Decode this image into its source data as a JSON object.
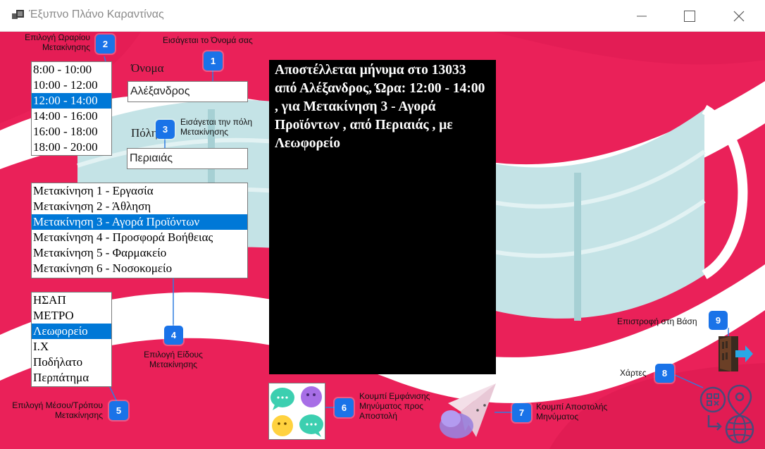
{
  "window": {
    "title": "Έξυπνο Πλάνο Καραντίνας"
  },
  "schedule": {
    "hint": "Επιλογή Ωραρίου Μετακίνησης",
    "hint_line1": "Επιλογή Ωραρίου",
    "hint_line2": "Μετακίνησης",
    "badge": "2",
    "items": [
      "8:00 - 10:00",
      "10:00 - 12:00",
      "12:00 - 14:00",
      "14:00 - 16:00",
      "16:00 - 18:00",
      "18:00 - 20:00"
    ],
    "selected_index": 2
  },
  "name_field": {
    "hint": "Εισάγεται το Όνομά σας",
    "label": "Όνομα",
    "value": "Αλέξανδρος",
    "badge": "1"
  },
  "city_field": {
    "hint_line1": "Εισάγεται την πόλη",
    "hint_line2": "Μετακίνησης",
    "label": "Πόλη",
    "value": "Περιαιάς",
    "badge": "3"
  },
  "movement_type": {
    "hint_line1": "Επιλογή Είδους",
    "hint_line2": "Μετακίνησης",
    "badge": "4",
    "items": [
      "Μετακίνηση 1 - Εργασία",
      "Μετακίνηση 2 - Άθληση",
      "Μετακίνηση 3 - Αγορά Προϊόντων",
      "Μετακίνηση 4 - Προσφορά Βοήθειας",
      "Μετακίνηση 5 - Φαρμακείο",
      "Μετακίνηση 6 - Νοσοκομείο"
    ],
    "selected_index": 2
  },
  "transport": {
    "hint_line1": "Επιλογή Μέσου/Τρόπου",
    "hint_line2": "Μετακίνησης",
    "badge": "5",
    "items": [
      "ΗΣΑΠ",
      "ΜΕΤΡΟ",
      "Λεωφορείο",
      "Ι.Χ",
      "Ποδήλατο",
      "Περπάτημα"
    ],
    "selected_index": 2
  },
  "message": {
    "text": "Αποστέλλεται μήνυμα στο 13033 από Αλέξανδρος, Ώρα: 12:00 - 14:00  , για Μετακίνηση 3 - Αγορά Προϊόντων  ,  από Περιαιάς ,  με Λεωφορείο"
  },
  "show_message_button": {
    "hint_line1": "Κουμπί Εμφάνισης",
    "hint_line2": "Μηνύματος προς",
    "hint_line3": "Αποστολή",
    "badge": "6",
    "icon": "chat-bubbles-icon"
  },
  "send_button": {
    "hint_line1": "Κουμπί Αποστολής",
    "hint_line2": "Μηνύματος",
    "badge": "7",
    "icon": "paper-plane-icon"
  },
  "maps_button": {
    "hint": "Χάρτες",
    "badge": "8",
    "icon": "map-location-icon"
  },
  "home_button": {
    "hint": "Επιστροφή στη Βάση",
    "badge": "9",
    "icon": "exit-door-icon"
  },
  "colors": {
    "background": "#ea2159",
    "selection": "#0078d7",
    "badge": "#1a73e8",
    "mask": "#b9dde0"
  }
}
